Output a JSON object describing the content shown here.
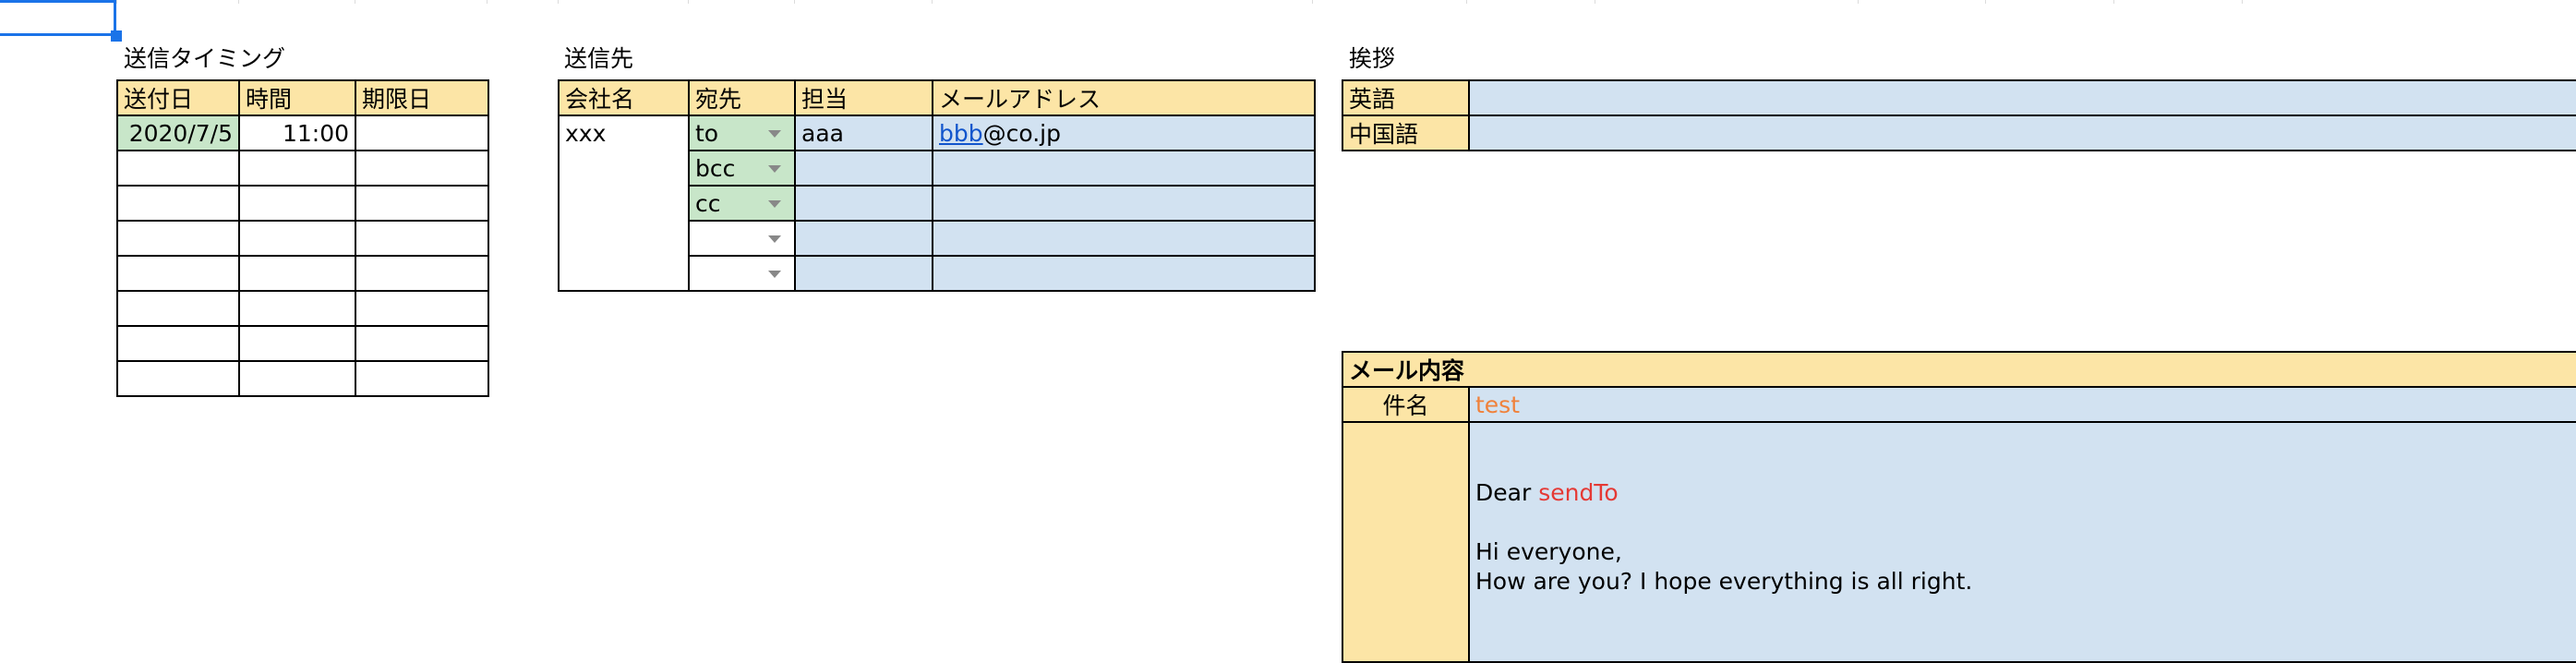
{
  "timing": {
    "title": "送信タイミング",
    "headers": [
      "送付日",
      "時間",
      "期限日"
    ],
    "rows": [
      [
        "2020/7/5",
        "11:00",
        ""
      ],
      [
        "",
        "",
        ""
      ],
      [
        "",
        "",
        ""
      ],
      [
        "",
        "",
        ""
      ],
      [
        "",
        "",
        ""
      ],
      [
        "",
        "",
        ""
      ],
      [
        "",
        "",
        ""
      ],
      [
        "",
        "",
        ""
      ]
    ]
  },
  "recipients": {
    "title": "送信先",
    "headers": [
      "会社名",
      "宛先",
      "担当",
      "メールアドレス"
    ],
    "company": "xxx",
    "rows": [
      {
        "type": "to",
        "person": "aaa",
        "email_user": "bbb",
        "email_domain": "@co.jp"
      },
      {
        "type": "bcc",
        "person": "",
        "email_user": "",
        "email_domain": ""
      },
      {
        "type": "cc",
        "person": "",
        "email_user": "",
        "email_domain": ""
      },
      {
        "type": "",
        "person": "",
        "email_user": "",
        "email_domain": ""
      },
      {
        "type": "",
        "person": "",
        "email_user": "",
        "email_domain": ""
      }
    ]
  },
  "greeting": {
    "title": "挨拶",
    "rows": [
      {
        "label": "英語",
        "value": ""
      },
      {
        "label": "中国語",
        "value": ""
      }
    ]
  },
  "mail": {
    "title": "メール内容",
    "subject_label": "件名",
    "subject": "test",
    "body_dear": "Dear",
    "body_sendto": "sendTo",
    "body_line1": "Hi everyone,",
    "body_line2": "How are you? I hope everything is all right."
  },
  "colors": {
    "header_fill": "#fce5a6",
    "green_fill": "#c8e6c9",
    "blue_fill": "#d2e2f1",
    "selection": "#1a73e8",
    "subject_text": "#f0813a",
    "placeholder_text": "#e53935"
  }
}
